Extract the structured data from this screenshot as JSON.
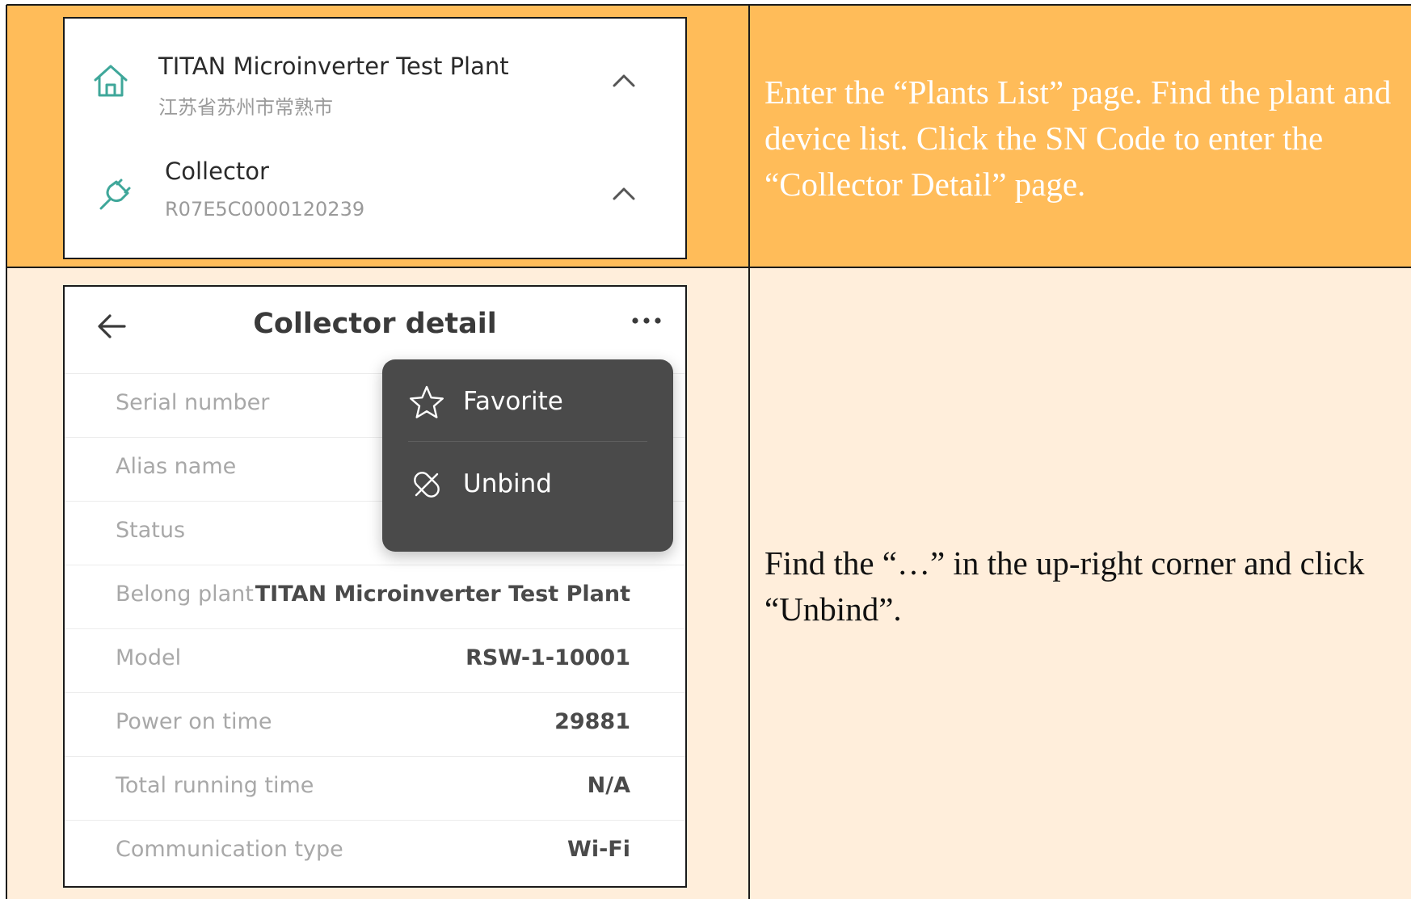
{
  "step1": {
    "plant_list": {
      "plant": {
        "name": "TITAN Microinverter Test Plant",
        "location": "江苏省苏州市常熟市"
      },
      "device": {
        "type": "Collector",
        "sn": "R07E5C0000120239"
      }
    },
    "instruction": "Enter the “Plants List” page. Find the plant and device list. Click the SN Code to enter the “Collector Detail” page."
  },
  "step2": {
    "collector_detail": {
      "title": "Collector detail",
      "menu": {
        "favorite": "Favorite",
        "unbind": "Unbind"
      },
      "rows": [
        {
          "label": "Serial number",
          "value": ""
        },
        {
          "label": "Alias name",
          "value": ""
        },
        {
          "label": "Status",
          "value": ""
        },
        {
          "label": "Belong plant",
          "value": "TITAN Microinverter Test Plant"
        },
        {
          "label": "Model",
          "value": "RSW-1-10001"
        },
        {
          "label": "Power on time",
          "value": "29881"
        },
        {
          "label": "Total running time",
          "value": "N/A"
        },
        {
          "label": "Communication type",
          "value": "Wi-Fi"
        }
      ]
    },
    "instruction": "Find the “…” in the up-right corner and click “Unbind”."
  },
  "colors": {
    "header_row_bg": "#ffbc59",
    "body_row_bg": "#ffeedb",
    "accent_icon": "#3fa79a",
    "popup_bg": "#4a4a4a"
  },
  "icons": [
    "home-icon",
    "plug-icon",
    "chevron-up-icon",
    "back-arrow-icon",
    "more-icon",
    "star-icon",
    "unlink-icon"
  ]
}
